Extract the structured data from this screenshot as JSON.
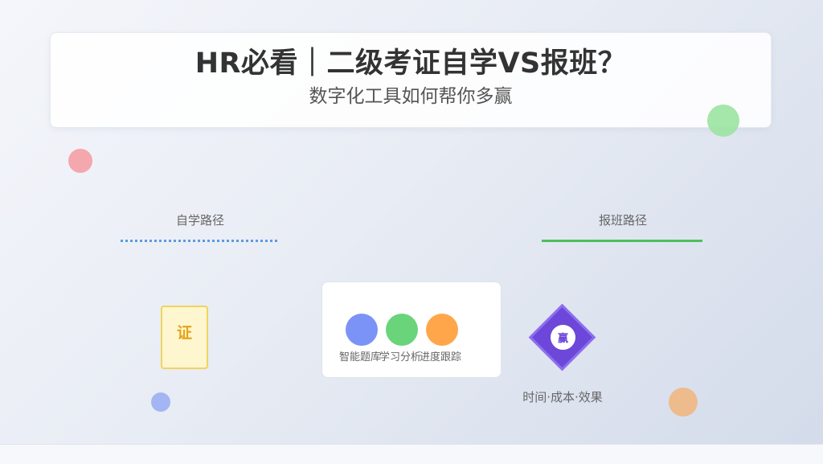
{
  "header": {
    "title": "HR必看｜二级考证自学VS报班？",
    "subtitle": "数字化工具如何帮你多赢"
  },
  "paths": {
    "self_study": {
      "label": "自学路径",
      "color": "#5b9be0"
    },
    "class": {
      "label": "报班路径",
      "color": "#4cbf5c"
    }
  },
  "certificate": {
    "glyph": "证"
  },
  "tools": {
    "items": [
      {
        "label": "智能题库",
        "color": "#7b93f7"
      },
      {
        "label": "学习分析",
        "color": "#6ad47a"
      },
      {
        "label": "进度跟踪",
        "color": "#ffa64a"
      }
    ]
  },
  "win": {
    "glyph": "赢",
    "caption": "时间·成本·效果",
    "color": "#6d47d9"
  },
  "decor_colors": {
    "pink": "#f4a7ad",
    "green": "#9be3a1",
    "blue": "#a4b5f3",
    "orange": "#eebb8d"
  }
}
